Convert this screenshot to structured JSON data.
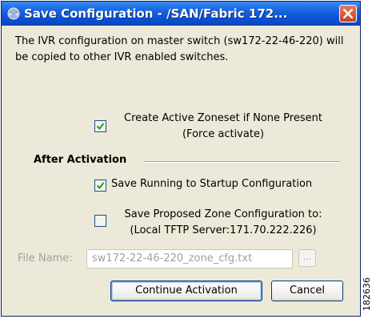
{
  "window": {
    "title": "Save Configuration - /SAN/Fabric 172...",
    "close_label": "close"
  },
  "message": "The IVR configuration on master switch (sw172-22-46-220) will be copied to other IVR enabled switches.",
  "options": {
    "create_zoneset": {
      "line1": "Create Active Zoneset if None Present",
      "line2": "(Force activate)",
      "checked": true
    }
  },
  "after_activation": {
    "heading": "After Activation",
    "save_running": {
      "label": "Save Running to Startup Configuration",
      "checked": true
    },
    "save_proposed": {
      "line1": "Save Proposed Zone Configuration to:",
      "line2": "(Local TFTP Server:171.70.222.226)",
      "checked": false
    }
  },
  "file": {
    "label": "File Name:",
    "value": "sw172-22-46-220_zone_cfg.txt",
    "browse_label": "..."
  },
  "buttons": {
    "continue": "Continue Activation",
    "cancel": "Cancel"
  },
  "figure_id": "182636",
  "colors": {
    "titlebar": "#0a52d6",
    "dialog_bg": "#ece9d8",
    "close_button": "#c8421e",
    "checkmark": "#21a121",
    "disabled_text": "#a0a0a0"
  }
}
